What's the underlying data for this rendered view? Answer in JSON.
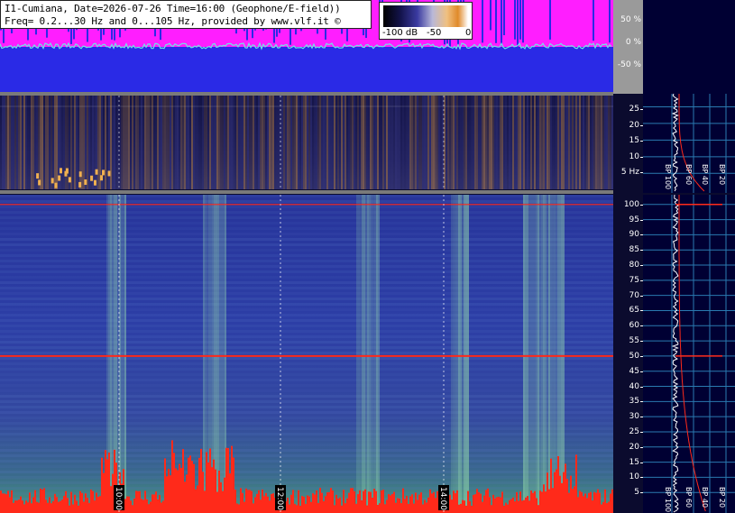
{
  "header": {
    "line1": "I1-Cumiana, Date=2026-07-26 Time=16:00 (Geophone/E-field))",
    "line2": "Freq= 0.2...30 Hz and 0...105 Hz, provided by www.vlf.it ©"
  },
  "colorbar": {
    "labels": [
      "-100 dB",
      "-50",
      "0"
    ]
  },
  "colors": {
    "magenta": "#ff1eff",
    "blue": "#2a2ae6",
    "trace": "#6fe6e6",
    "red": "#ff2a1a",
    "white": "#ffffff"
  },
  "chart_data": [
    {
      "type": "line",
      "panel": "top-percent-strip",
      "y_tick_labels": [
        "50 %",
        "0 %",
        "-50 %"
      ],
      "ylim": [
        -100,
        100
      ]
    },
    {
      "type": "heatmap",
      "panel": "spectrogram-0-30Hz",
      "y_ticks": [
        25,
        20,
        15,
        10,
        5
      ],
      "y_tick_labels": [
        "25",
        "20",
        "15",
        "10",
        "5 Hz"
      ],
      "ylim": [
        0.2,
        30
      ],
      "colorbar_db": [
        -100,
        0
      ]
    },
    {
      "type": "heatmap",
      "panel": "spectrogram-0-105Hz",
      "y_ticks": [
        100,
        95,
        90,
        85,
        80,
        75,
        70,
        65,
        60,
        55,
        50,
        45,
        40,
        35,
        30,
        25,
        20,
        15,
        10,
        5
      ],
      "ylim": [
        0,
        105
      ],
      "time_markers": [
        "10:00",
        "12:00",
        "14:00"
      ],
      "profile_labels": [
        "BP 100",
        "BP 60",
        "BP 40",
        "BP 20"
      ]
    }
  ]
}
